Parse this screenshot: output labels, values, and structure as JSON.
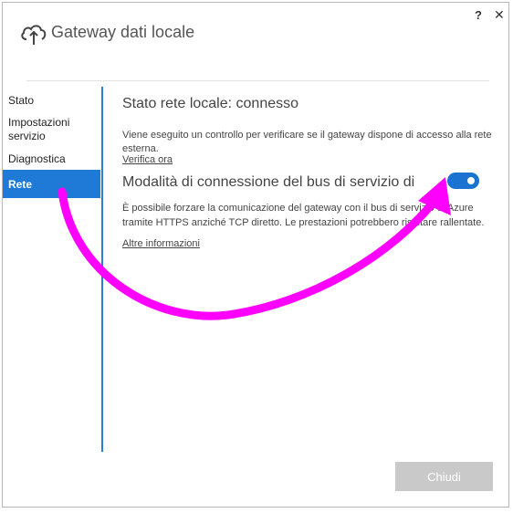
{
  "window": {
    "title": "Gateway dati locale",
    "help_label": "?",
    "close_label": "✕"
  },
  "nav": {
    "items": [
      "Stato",
      "Impostazioni",
      "servizio",
      "Diagnostica"
    ],
    "active_label": "Rete"
  },
  "main": {
    "status_heading": "Stato rete locale: connesso",
    "status_text": "Viene eseguito un controllo per verificare se il gateway dispone di accesso alla rete esterna.",
    "verify_link": "Verifica ora",
    "bus_heading": "Modalità di connessione del bus di servizio di",
    "bus_text": "È possibile forzare la comunicazione del gateway con il bus di servizio di Azure tramite HTTPS anziché TCP diretto. Le prestazioni potrebbero risultare rallentate.",
    "more_link": "Altre informazioni",
    "toggle_state": "on"
  },
  "footer": {
    "close_button": "Chiudi"
  },
  "colors": {
    "accent": "#1e7ad6",
    "annotation": "#ff00ff"
  },
  "icons": [
    "cloud-upload-icon"
  ]
}
